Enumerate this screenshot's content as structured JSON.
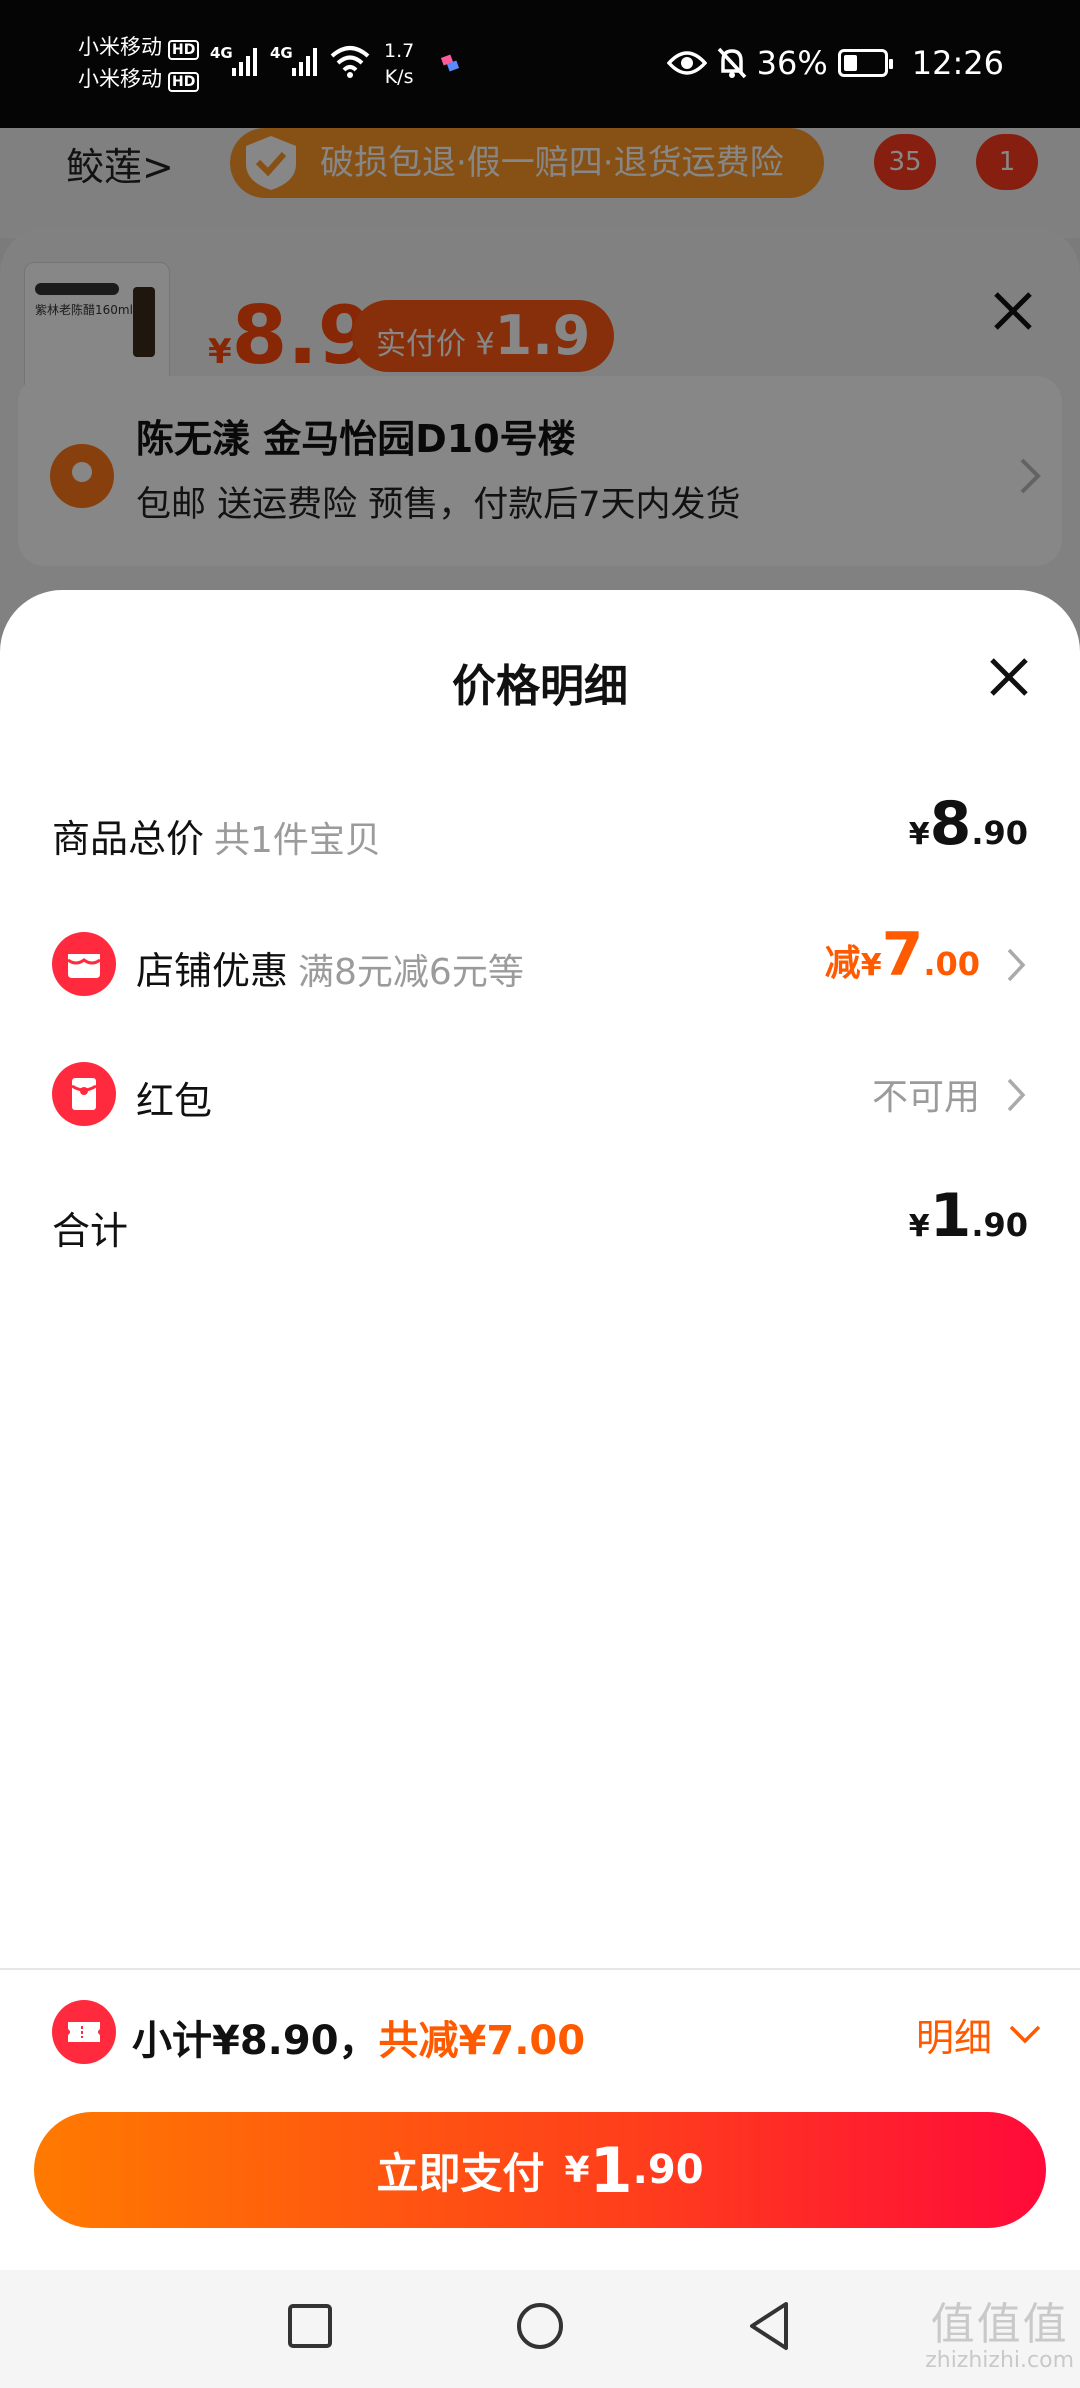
{
  "status_bar": {
    "carrier1": "小米移动",
    "carrier2": "小米移动",
    "hd": "HD",
    "network": "4G",
    "speed_value": "1.7",
    "speed_unit": "K/s",
    "battery": "36%",
    "battery_level": 0.36,
    "time": "12:26"
  },
  "background": {
    "breadcrumb": "鲛莲>",
    "guarantee": "破损包退·假一赔四·退货运费险",
    "badge1": "35",
    "badge2": "1",
    "thumb_label": "紫林老陈醋160ml",
    "price_currency": "¥",
    "price": "8.9",
    "actual_label": "实付价",
    "actual_currency": "¥",
    "actual_price": "1.9",
    "address_name": "陈无漾 金马怡园D10号楼",
    "shipping": "包邮 送运费险 预售，付款后7天内发货"
  },
  "sheet": {
    "title": "价格明细",
    "total": {
      "label": "商品总价",
      "sub": "共1件宝贝",
      "currency": "¥",
      "int": "8",
      "dec": ".90"
    },
    "shop": {
      "label": "店铺优惠",
      "sub": "满8元减6元等",
      "prefix": "减",
      "currency": "¥",
      "int": "7",
      "dec": ".00"
    },
    "redpacket": {
      "label": "红包",
      "value": "不可用"
    },
    "sum": {
      "label": "合计",
      "currency": "¥",
      "int": "1",
      "dec": ".90"
    }
  },
  "footer": {
    "subtotal": "小计¥8.90，",
    "discount": "共减¥7.00",
    "detail": "明细",
    "pay_label": "立即支付",
    "pay_currency": "¥",
    "pay_int": "1",
    "pay_dec": ".90"
  },
  "watermark": {
    "big": "值值值",
    "small": "zhizhizhi.com"
  },
  "colors": {
    "accent": "#ff5a00",
    "red_icon": "#ff2a3d",
    "pay_gradient_start": "#ff7a00",
    "pay_gradient_end": "#ff0a3a"
  }
}
